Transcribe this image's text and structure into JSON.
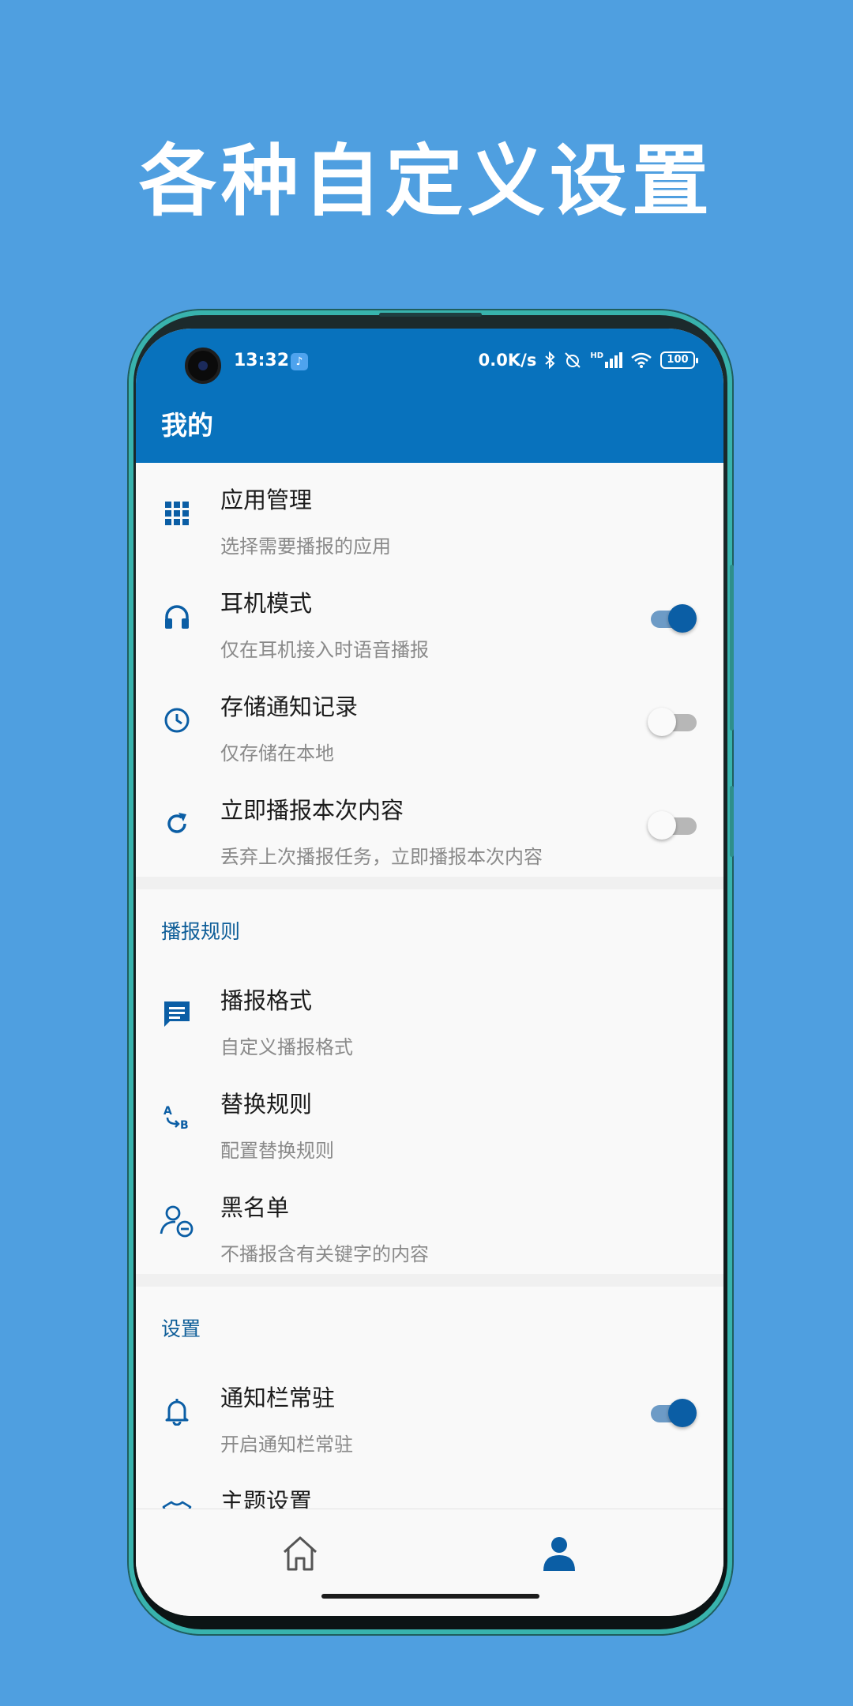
{
  "headline": "各种自定义设置",
  "status_bar": {
    "time": "13:32",
    "network_speed": "0.0K/s",
    "hd_label": "HD",
    "battery": "100"
  },
  "app_bar": {
    "title": "我的"
  },
  "general": {
    "items": [
      {
        "title": "应用管理",
        "subtitle": "选择需要播报的应用",
        "icon": "apps-grid-icon"
      },
      {
        "title": "耳机模式",
        "subtitle": "仅在耳机接入时语音播报",
        "icon": "headphones-icon",
        "switch_on": true
      },
      {
        "title": "存储通知记录",
        "subtitle": "仅存储在本地",
        "icon": "clock-icon",
        "switch_on": false
      },
      {
        "title": "立即播报本次内容",
        "subtitle": "丢弃上次播报任务，立即播报本次内容",
        "icon": "refresh-icon",
        "switch_on": false
      }
    ]
  },
  "broadcast_rules": {
    "header": "播报规则",
    "items": [
      {
        "title": "播报格式",
        "subtitle": "自定义播报格式",
        "icon": "message-icon"
      },
      {
        "title": "替换规则",
        "subtitle": "配置替换规则",
        "icon": "a-to-b-icon"
      },
      {
        "title": "黑名单",
        "subtitle": "不播报含有关键字的内容",
        "icon": "user-block-icon"
      }
    ]
  },
  "settings": {
    "header": "设置",
    "items": [
      {
        "title": "通知栏常驻",
        "subtitle": "开启通知栏常驻",
        "icon": "bell-icon",
        "switch_on": true
      },
      {
        "title": "主题设置",
        "subtitle": "",
        "icon": "shirt-icon"
      }
    ]
  },
  "bottom_nav": {
    "items": [
      {
        "icon": "home-icon",
        "active": false
      },
      {
        "icon": "person-icon",
        "active": true
      }
    ]
  },
  "colors": {
    "background": "#4f9fe0",
    "primary": "#0872bd",
    "accent": "#0b5ea5",
    "section_header": "#0d5d98"
  }
}
